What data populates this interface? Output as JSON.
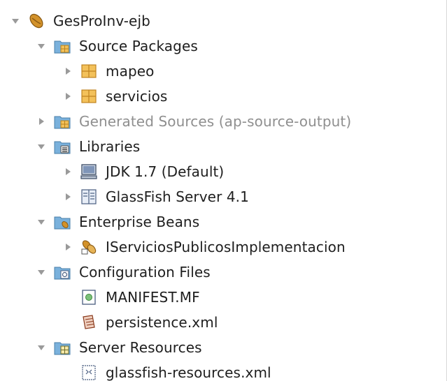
{
  "tree": {
    "project": {
      "label": "GesProInv-ejb",
      "icon": "project-bean-icon",
      "expanded": true
    },
    "source_packages": {
      "label": "Source Packages",
      "icon": "source-packages-folder-icon",
      "expanded": true,
      "children": [
        {
          "label": "mapeo",
          "icon": "package-icon",
          "expanded": false
        },
        {
          "label": "servicios",
          "icon": "package-icon",
          "expanded": false
        }
      ]
    },
    "generated_sources": {
      "label": "Generated Sources (ap-source-output)",
      "icon": "generated-sources-folder-icon",
      "expanded": false,
      "muted": true
    },
    "libraries": {
      "label": "Libraries",
      "icon": "libraries-folder-icon",
      "expanded": true,
      "children": [
        {
          "label": "JDK 1.7 (Default)",
          "icon": "jdk-platform-icon",
          "expanded": false
        },
        {
          "label": "GlassFish Server 4.1",
          "icon": "server-library-icon",
          "expanded": false
        }
      ]
    },
    "enterprise_beans": {
      "label": "Enterprise Beans",
      "icon": "enterprise-beans-folder-icon",
      "expanded": true,
      "children": [
        {
          "label": "IServiciosPublicosImplementacion",
          "icon": "session-bean-icon",
          "expanded": false
        }
      ]
    },
    "configuration_files": {
      "label": "Configuration Files",
      "icon": "configuration-folder-icon",
      "expanded": true,
      "children": [
        {
          "label": "MANIFEST.MF",
          "icon": "manifest-file-icon"
        },
        {
          "label": "persistence.xml",
          "icon": "persistence-file-icon"
        }
      ]
    },
    "server_resources": {
      "label": "Server Resources",
      "icon": "server-resources-folder-icon",
      "expanded": true,
      "children": [
        {
          "label": "glassfish-resources.xml",
          "icon": "xml-resource-file-icon"
        }
      ]
    }
  },
  "colors": {
    "text": "#1e1e1e",
    "muted_text": "#8f8f8f",
    "toggle_arrow": "#9a9a9a",
    "folder_blue": "#7ab1dc",
    "package_orange": "#e7a63c"
  }
}
